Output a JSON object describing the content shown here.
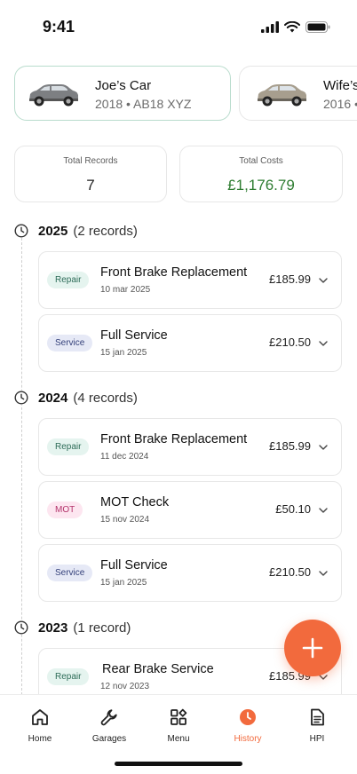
{
  "status_bar": {
    "time": "9:41"
  },
  "vehicles": [
    {
      "name": "Joe’s Car",
      "year": "2018",
      "reg": "AB18 XYZ",
      "meta": "2018  •  AB18 XYZ",
      "selected": true
    },
    {
      "name": "Wife’s",
      "year": "2016",
      "meta": "2016  •",
      "selected": false
    }
  ],
  "stats": {
    "total_records_label": "Total Records",
    "total_records_value": "7",
    "total_costs_label": "Total Costs",
    "total_costs_value": "£1,176.79"
  },
  "years": [
    {
      "year": "2025",
      "count": "(2 records)"
    },
    {
      "year": "2024",
      "count": "(4 records)"
    },
    {
      "year": "2023",
      "count": "(1 record)"
    }
  ],
  "records": [
    {
      "badge": "Repair",
      "title": "Front Brake Replacement",
      "date": "10 mar 2025",
      "price": "£185.99"
    },
    {
      "badge": "Service",
      "title": "Full Service",
      "date": "15 jan 2025",
      "price": "£210.50"
    },
    {
      "badge": "Repair",
      "title": "Front Brake Replacement",
      "date": "11 dec 2024",
      "price": "£185.99"
    },
    {
      "badge": "MOT",
      "title": "MOT Check",
      "date": "15 nov 2024",
      "price": "£50.10"
    },
    {
      "badge": "Service",
      "title": "Full Service",
      "date": "15 jan 2025",
      "price": "£210.50"
    },
    {
      "badge": "Repair",
      "title": "Rear Brake Service",
      "date": "12 nov 2023",
      "price": "£185.99"
    }
  ],
  "tabs": [
    {
      "label": "Home",
      "icon": "home-icon"
    },
    {
      "label": "Garages",
      "icon": "wrench-icon"
    },
    {
      "label": "Menu",
      "icon": "grid-icon"
    },
    {
      "label": "History",
      "icon": "history-icon",
      "active": true
    },
    {
      "label": "HPI",
      "icon": "document-icon"
    }
  ],
  "colors": {
    "accent": "#f26a3d",
    "cost_green": "#2f7d32",
    "selected_card_border": "#b9dccd"
  }
}
